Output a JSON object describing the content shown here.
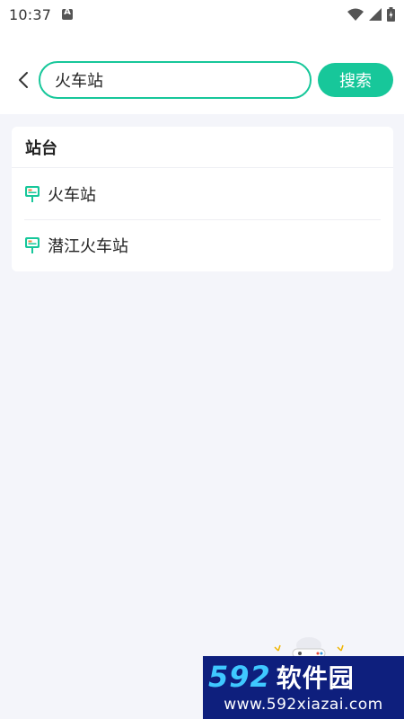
{
  "status_bar": {
    "time": "10:37"
  },
  "search": {
    "value": "火车站",
    "button_label": "搜索"
  },
  "results": {
    "section_title": "站台",
    "items": [
      {
        "label": "火车站",
        "icon": "station-sign-icon"
      },
      {
        "label": "潜江火车站",
        "icon": "station-sign-icon"
      }
    ]
  },
  "watermark": {
    "brand_number": "592",
    "brand_name": "软件园",
    "url": "www.592xiazai.com"
  },
  "colors": {
    "accent": "#17c79a",
    "background": "#f4f5fa",
    "card": "#ffffff"
  }
}
